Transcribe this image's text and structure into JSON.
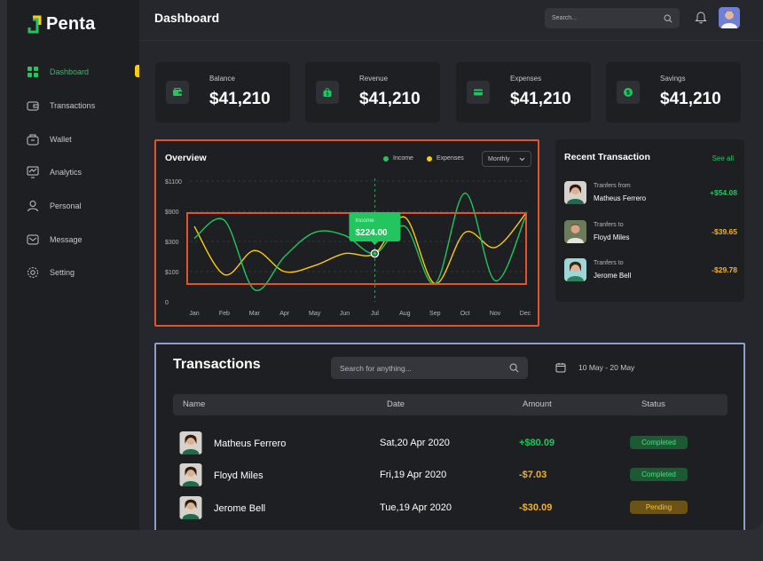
{
  "brand": {
    "name": "Penta"
  },
  "colors": {
    "accent": "#22c55e",
    "income": "#22c55e",
    "expenses": "#facc15",
    "panel": "#1e1f23",
    "background": "#25272c",
    "active_marker": "#facc15"
  },
  "sidebar": {
    "items": [
      {
        "label": "Dashboard",
        "icon": "grid-icon",
        "active": true
      },
      {
        "label": "Transactions",
        "icon": "card-icon",
        "active": false
      },
      {
        "label": "Wallet",
        "icon": "wallet-icon",
        "active": false
      },
      {
        "label": "Analytics",
        "icon": "analytics-icon",
        "active": false
      },
      {
        "label": "Personal",
        "icon": "user-icon",
        "active": false
      },
      {
        "label": "Message",
        "icon": "mail-icon",
        "active": false
      },
      {
        "label": "Setting",
        "icon": "gear-icon",
        "active": false
      }
    ]
  },
  "header": {
    "title": "Dashboard",
    "search_placeholder": "Search..."
  },
  "stats": [
    {
      "label": "Balance",
      "value": "$41,210",
      "icon": "wallet-icon"
    },
    {
      "label": "Revenue",
      "value": "$41,210",
      "icon": "bag-icon"
    },
    {
      "label": "Expenses",
      "value": "$41,210",
      "icon": "card-icon"
    },
    {
      "label": "Savings",
      "value": "$41,210",
      "icon": "dollar-icon"
    }
  ],
  "overview": {
    "title": "Overview",
    "legend_income": "Income",
    "legend_expenses": "Expenses",
    "period": "Monthly",
    "tooltip_label": "Income",
    "tooltip_value": "$224.00"
  },
  "chart_data": {
    "type": "line",
    "x": [
      "Jan",
      "Feb",
      "Mar",
      "Apr",
      "May",
      "Jun",
      "Jul",
      "Aug",
      "Sep",
      "Oct",
      "Nov",
      "Dec"
    ],
    "y_ticks": [
      "$1100",
      "$900",
      "$300",
      "$100",
      "0"
    ],
    "series": [
      {
        "name": "Income",
        "color": "#22c55e",
        "values": [
          2.1,
          2.7,
          0.4,
          1.5,
          2.3,
          2.2,
          1.6,
          2.5,
          0.6,
          3.6,
          0.7,
          2.8
        ]
      },
      {
        "name": "Expenses",
        "color": "#facc15",
        "values": [
          2.5,
          0.9,
          1.7,
          1.0,
          1.2,
          1.6,
          1.6,
          2.8,
          0.6,
          2.3,
          1.8,
          2.9
        ]
      }
    ],
    "highlight": {
      "series": "Income",
      "index": 6,
      "label": "Income",
      "value": "$224.00"
    },
    "ylim": [
      0,
      4
    ],
    "grid": true,
    "legend": "top-right"
  },
  "recent": {
    "title": "Recent Transaction",
    "see_all": "See all",
    "items": [
      {
        "sub": "Tranfers from",
        "name": "Matheus Ferrero",
        "amount": "+$54.08",
        "sign": "pos"
      },
      {
        "sub": "Tranfers to",
        "name": "Floyd Miles",
        "amount": "-$39.65",
        "sign": "neg"
      },
      {
        "sub": "Tranfers to",
        "name": "Jerome Bell",
        "amount": "-$29.78",
        "sign": "neg"
      }
    ]
  },
  "transactions": {
    "title": "Transactions",
    "search_placeholder": "Search for anything...",
    "date_range": "10 May - 20 May",
    "columns": [
      "Name",
      "Date",
      "Amount",
      "Status"
    ],
    "rows": [
      {
        "name": "Matheus Ferrero",
        "date": "Sat,20 Apr 2020",
        "amount": "+$80.09",
        "status": "Completed",
        "status_kind": "completed",
        "sign": "pos"
      },
      {
        "name": "Floyd Miles",
        "date": "Fri,19 Apr 2020",
        "amount": "-$7.03",
        "status": "Completed",
        "status_kind": "completed",
        "sign": "neg"
      },
      {
        "name": "Jerome Bell",
        "date": "Tue,19 Apr 2020",
        "amount": "-$30.09",
        "status": "Pending",
        "status_kind": "pending",
        "sign": "neg"
      }
    ]
  }
}
